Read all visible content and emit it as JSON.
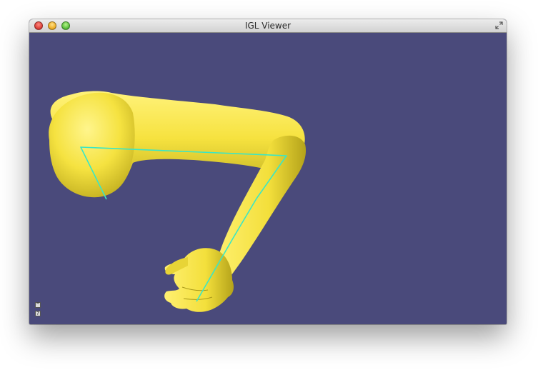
{
  "window": {
    "title": "IGL Viewer"
  },
  "titlebar": {
    "icons": [
      "close-icon",
      "minimize-icon",
      "zoom-icon",
      "fullscreen-icon"
    ]
  },
  "viewport": {
    "background_color": "#4a4a7b",
    "mesh_color": "#f5e44a",
    "skeleton_color": "#39e6c6"
  },
  "overlay_buttons": {
    "collapse_label": "^",
    "help_label": "?"
  }
}
